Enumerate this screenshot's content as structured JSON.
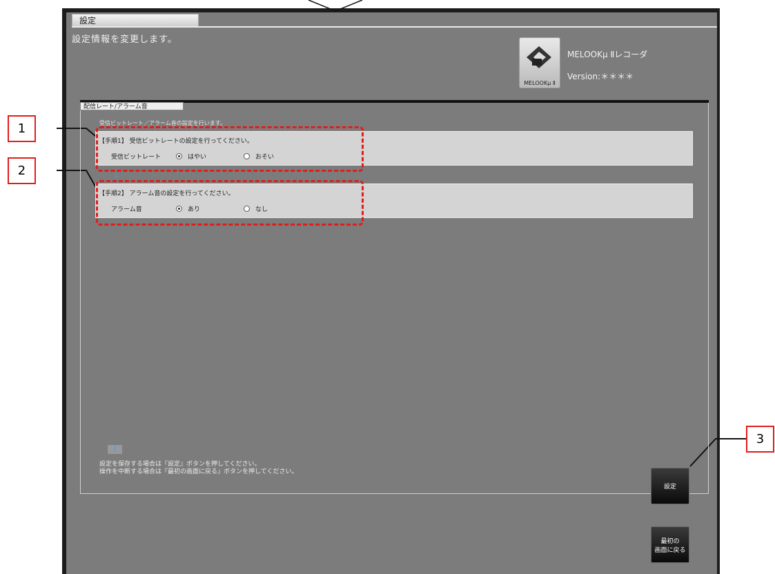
{
  "window": {
    "tab_title": "設定",
    "subtitle": "設定情報を変更します。"
  },
  "logo": {
    "caption": "MELOOKμ Ⅱ",
    "app_name": "MELOOKμ Ⅱレコーダ",
    "version": "Version:＊＊＊＊"
  },
  "panel": {
    "tab_label": "配信レート/アラーム音",
    "description": "受信ビットレート／アラーム音の設定を行います。",
    "steps": [
      {
        "title": "【手順1】 受信ビットレートの設定を行ってください。",
        "label": "受信ビットレート",
        "options": [
          {
            "label": "はやい",
            "selected": true
          },
          {
            "label": "おそい",
            "selected": false
          }
        ]
      },
      {
        "title": "【手順2】 アラーム音の設定を行ってください。",
        "label": "アラーム音",
        "options": [
          {
            "label": "あり",
            "selected": true
          },
          {
            "label": "なし",
            "selected": false
          }
        ]
      }
    ],
    "notes": [
      "設定を保存する場合は『設定』ボタンを押してください。",
      "操作を中断する場合は『最初の画面に戻る』ボタンを押してください。"
    ]
  },
  "buttons": {
    "set_label": "設定",
    "back_label_line1": "最初の",
    "back_label_line2": "画面に戻る"
  },
  "callouts": [
    "1",
    "2",
    "3"
  ],
  "colors": {
    "annotation": "#e31b1b",
    "arrow": "#3aa0ff",
    "background": "#7c7c7c"
  }
}
